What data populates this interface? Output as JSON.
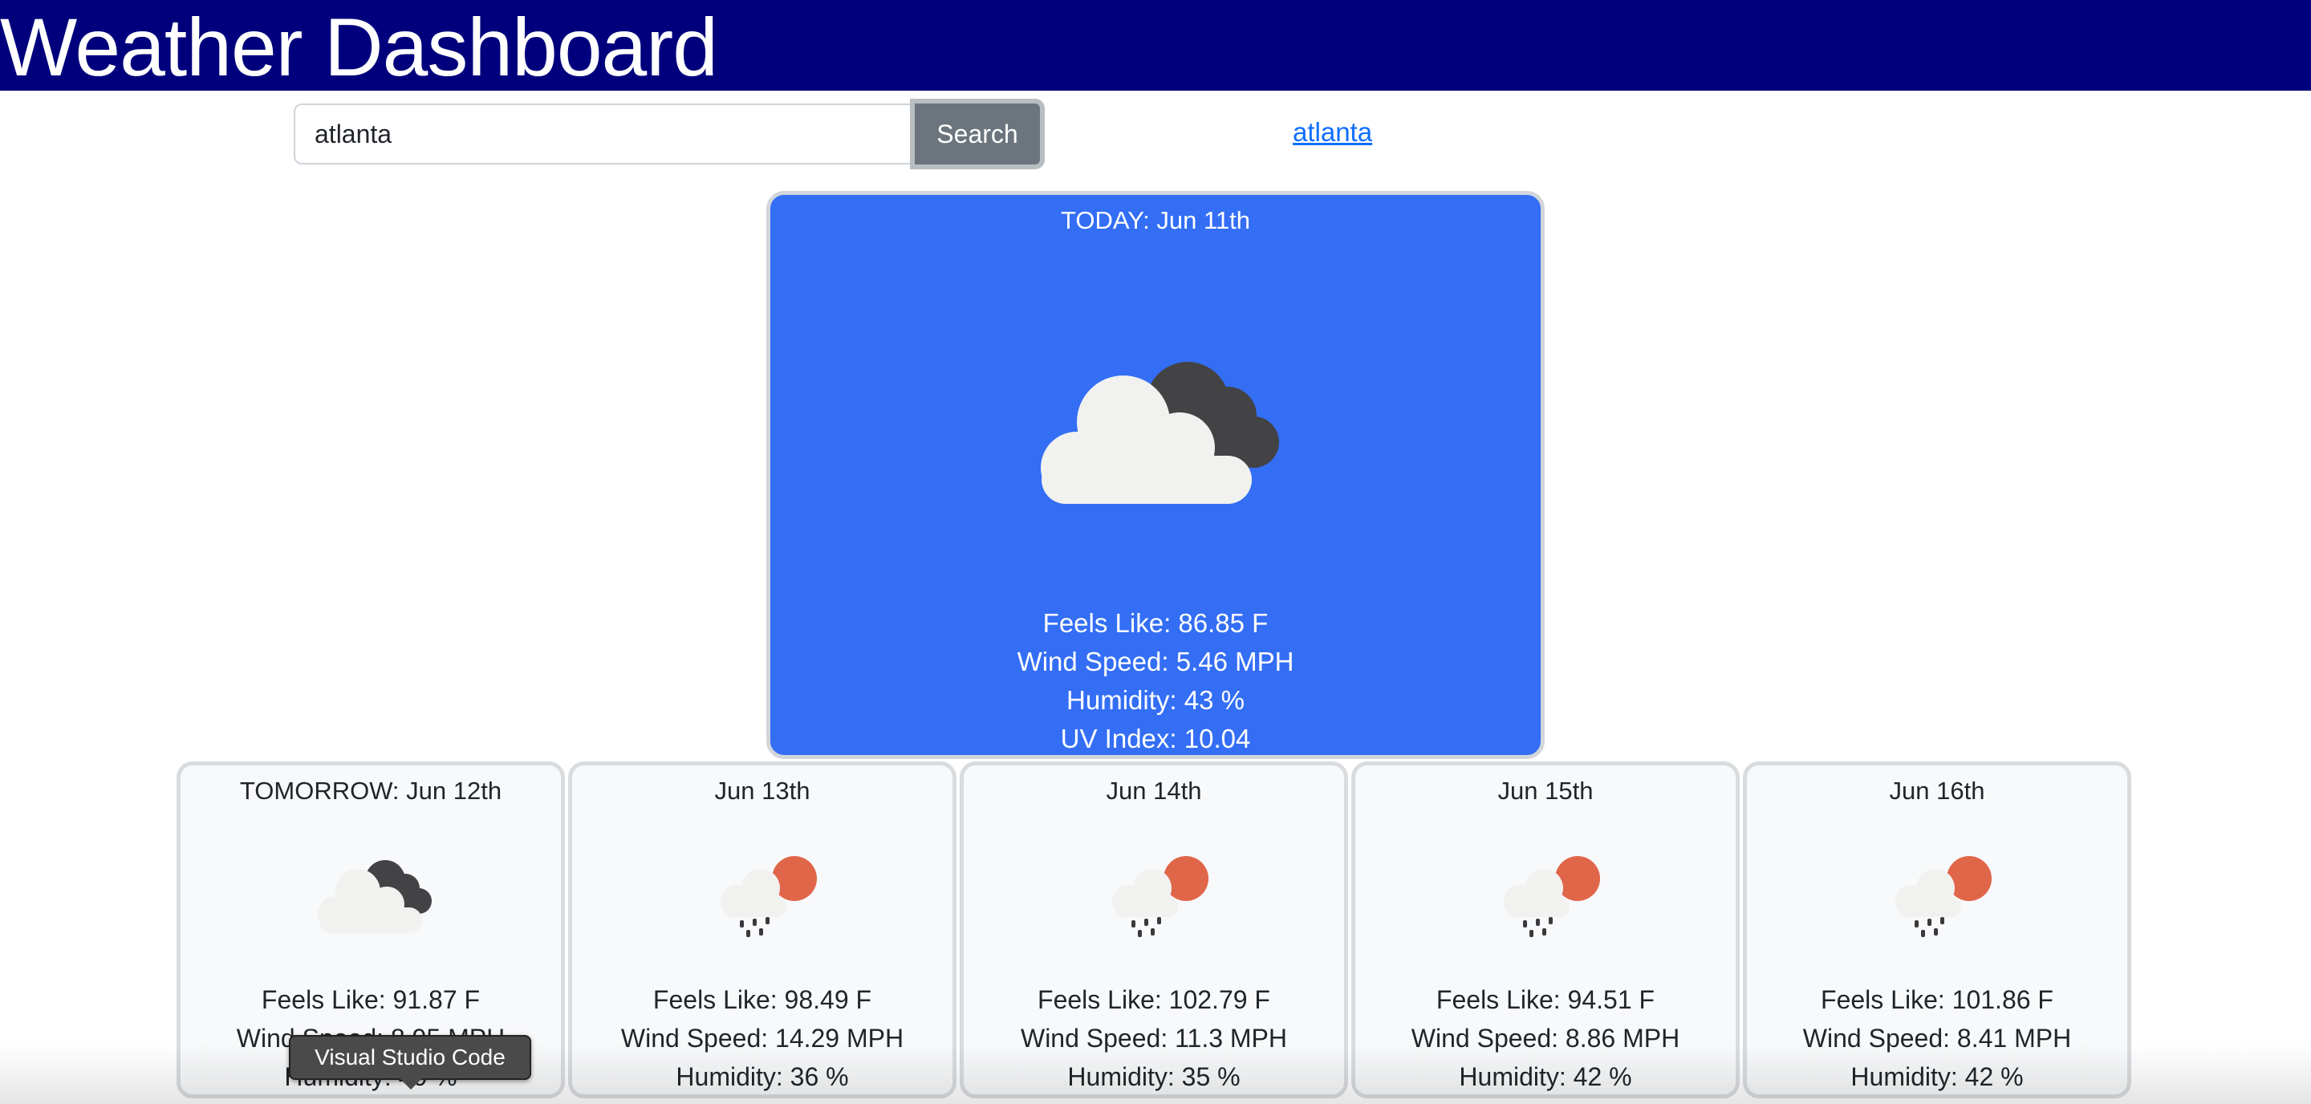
{
  "header": {
    "title": "Weather Dashboard"
  },
  "search": {
    "value": "atlanta",
    "button_label": "Search"
  },
  "history": {
    "links": [
      "atlanta"
    ]
  },
  "today": {
    "date_label": "TODAY: Jun 11th",
    "icon": "partly-cloudy-dark-icon",
    "feels_like": "Feels Like: 86.85 F",
    "wind": "Wind Speed: 5.46 MPH",
    "humidity": "Humidity: 43 %",
    "uv": "UV Index: 10.04"
  },
  "forecast": [
    {
      "date_label": "TOMORROW: Jun 12th",
      "icon": "cloudy-dark-icon",
      "feels_like": "Feels Like: 91.87 F",
      "wind": "Wind Speed: 8.95 MPH",
      "humidity": "Humidity: 40 %"
    },
    {
      "date_label": "Jun 13th",
      "icon": "rain-sun-icon",
      "feels_like": "Feels Like: 98.49 F",
      "wind": "Wind Speed: 14.29 MPH",
      "humidity": "Humidity: 36 %"
    },
    {
      "date_label": "Jun 14th",
      "icon": "rain-sun-icon",
      "feels_like": "Feels Like: 102.79 F",
      "wind": "Wind Speed: 11.3 MPH",
      "humidity": "Humidity: 35 %"
    },
    {
      "date_label": "Jun 15th",
      "icon": "rain-sun-icon",
      "feels_like": "Feels Like: 94.51 F",
      "wind": "Wind Speed: 8.86 MPH",
      "humidity": "Humidity: 42 %"
    },
    {
      "date_label": "Jun 16th",
      "icon": "rain-sun-icon",
      "feels_like": "Feels Like: 101.86 F",
      "wind": "Wind Speed: 8.41 MPH",
      "humidity": "Humidity: 42 %"
    }
  ],
  "tooltip": {
    "text": "Visual Studio Code"
  },
  "colors": {
    "header_bg": "#00007c",
    "today_bg": "#336ef5",
    "card_bg": "#f8f9fa",
    "button_bg": "#6c757d",
    "link": "#0d6efd",
    "sun": "#e0664a",
    "dark_cloud": "#434345",
    "light_cloud": "#f1f1f0"
  }
}
